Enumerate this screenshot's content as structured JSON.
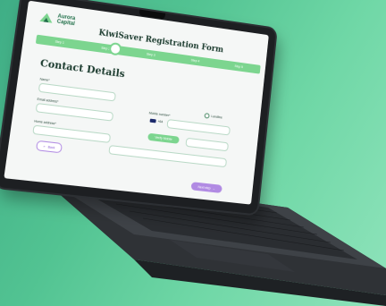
{
  "brand": {
    "line1": "Aurora",
    "line2": "Capital"
  },
  "form_title": "KiwiSaver Registration Form",
  "steps": [
    "Step 1",
    "Step 2",
    "Step 3",
    "Step 4",
    "Step 5"
  ],
  "section_title": "Contact Details",
  "fields": {
    "name_label": "Name*",
    "email_label": "Email address*",
    "mobile_label": "Mobile number*",
    "mobile_prefix": "+64",
    "home_label": "Home address*",
    "landline_option": "Landline"
  },
  "buttons": {
    "verify": "Verify Mobile",
    "back": "Back",
    "next": "Next step"
  },
  "colors": {
    "accent_green": "#7cd58f",
    "accent_purple": "#b18be3",
    "background": "#52c392"
  }
}
